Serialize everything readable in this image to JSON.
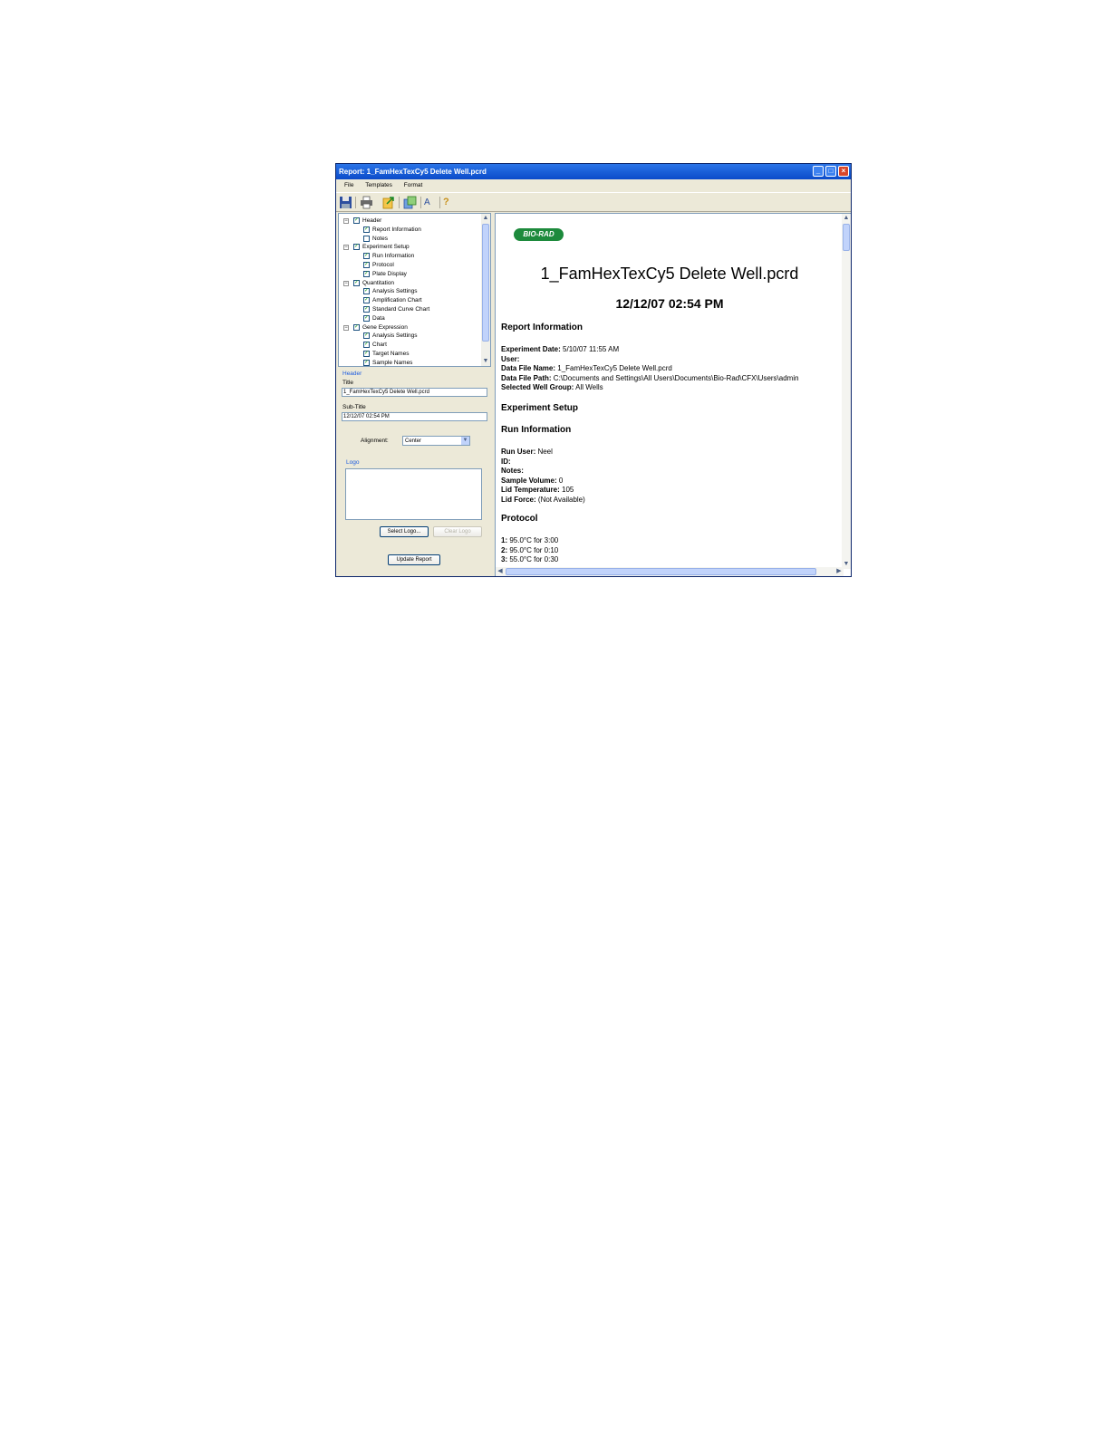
{
  "window": {
    "title": "Report: 1_FamHexTexCy5 Delete Well.pcrd"
  },
  "menu": [
    "File",
    "Templates",
    "Format"
  ],
  "toolbar": {
    "icons": [
      "save-icon",
      "print-icon",
      "export-icon",
      "template-icon",
      "font-icon",
      "help-icon"
    ],
    "help_glyph": "?",
    "font_glyph": "A"
  },
  "tree": {
    "items": [
      {
        "label": "Header",
        "level": 0,
        "checked": true,
        "expander": "−"
      },
      {
        "label": "Report Information",
        "level": 1,
        "checked": true
      },
      {
        "label": "Notes",
        "level": 1,
        "checked": false
      },
      {
        "label": "Experiment Setup",
        "level": 0,
        "checked": true,
        "expander": "−"
      },
      {
        "label": "Run Information",
        "level": 1,
        "checked": true
      },
      {
        "label": "Protocol",
        "level": 1,
        "checked": true
      },
      {
        "label": "Plate Display",
        "level": 1,
        "checked": true
      },
      {
        "label": "Quantitation",
        "level": 0,
        "checked": true,
        "expander": "−"
      },
      {
        "label": "Analysis Settings",
        "level": 1,
        "checked": true
      },
      {
        "label": "Amplification Chart",
        "level": 1,
        "checked": true
      },
      {
        "label": "Standard Curve Chart",
        "level": 1,
        "checked": true
      },
      {
        "label": "Data",
        "level": 1,
        "checked": true
      },
      {
        "label": "Gene Expression",
        "level": 0,
        "checked": true,
        "expander": "−"
      },
      {
        "label": "Analysis Settings",
        "level": 1,
        "checked": true
      },
      {
        "label": "Chart",
        "level": 1,
        "checked": true
      },
      {
        "label": "Target Names",
        "level": 1,
        "checked": true
      },
      {
        "label": "Sample Names",
        "level": 1,
        "checked": true
      }
    ]
  },
  "props": {
    "group_label": "Header",
    "title_label": "Title",
    "title_value": "1_FamHexTexCy5 Delete Well.pcrd",
    "subtitle_label": "Sub-Title",
    "subtitle_value": "12/12/07 02:54 PM",
    "alignment_label": "Alignment:",
    "alignment_value": "Center",
    "logo_label": "Logo",
    "select_logo": "Select Logo...",
    "clear_logo": "Clear Logo",
    "update_report": "Update Report"
  },
  "report": {
    "logo_text": "BIO-RAD",
    "title": "1_FamHexTexCy5 Delete Well.pcrd",
    "subtitle": "12/12/07 02:54 PM",
    "sections": {
      "report_info": "Report Information",
      "experiment_setup": "Experiment Setup",
      "run_info": "Run Information",
      "protocol": "Protocol"
    },
    "report_info": [
      {
        "label": "Experiment Date",
        "value": " 5/10/07 11:55 AM"
      },
      {
        "label": "User",
        "value": ""
      },
      {
        "label": "Data File Name",
        "value": " 1_FamHexTexCy5 Delete Well.pcrd"
      },
      {
        "label": "Data File Path",
        "value": " C:\\Documents and Settings\\All Users\\Documents\\Bio-Rad\\CFX\\Users\\admin"
      },
      {
        "label": "Selected Well Group",
        "value": " All Wells"
      }
    ],
    "run_info": [
      {
        "label": "Run User",
        "value": " Neel"
      },
      {
        "label": "ID",
        "value": ""
      },
      {
        "label": "Notes",
        "value": ""
      },
      {
        "label": "Sample Volume",
        "value": " 0"
      },
      {
        "label": "Lid Temperature",
        "value": " 105"
      },
      {
        "label": "Lid Force",
        "value": " (Not Available)"
      }
    ],
    "protocol": [
      {
        "label": "1",
        "value": " 95.0°C for 3:00"
      },
      {
        "label": "2",
        "value": " 95.0°C for 0:10"
      },
      {
        "label": "3",
        "value": " 55.0°C for 0:30"
      }
    ]
  }
}
